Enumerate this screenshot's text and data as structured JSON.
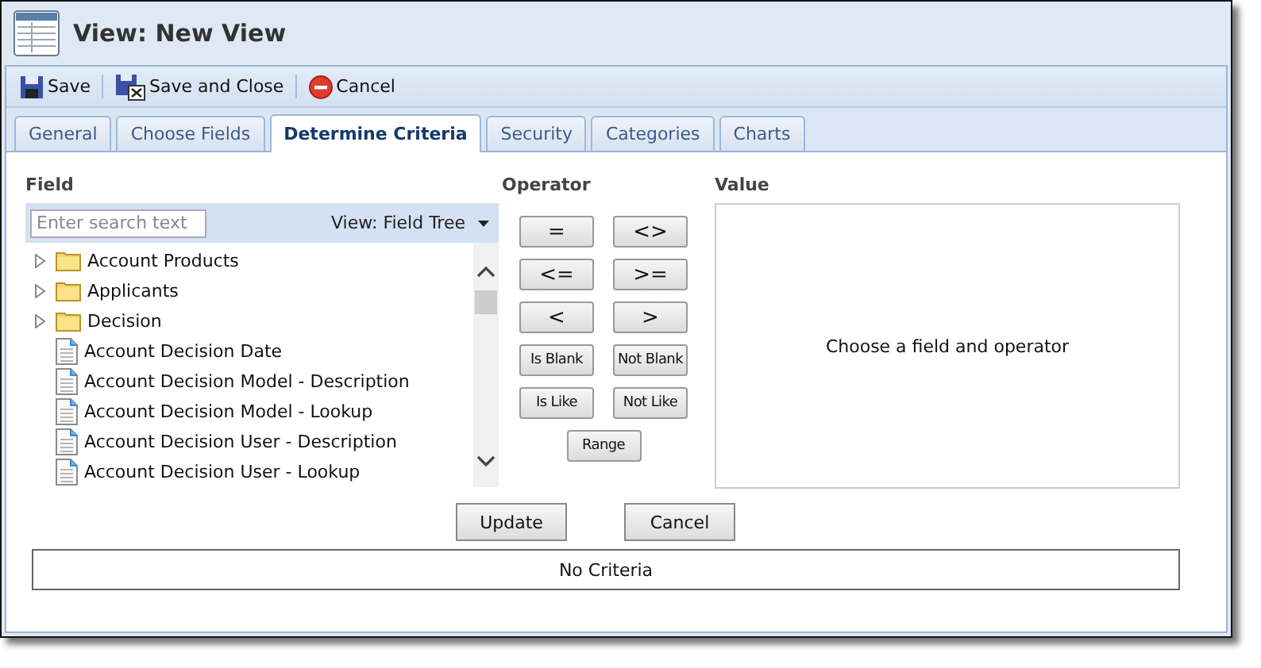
{
  "window": {
    "title": "View: New View"
  },
  "toolbar": [
    {
      "label": "Save",
      "kind": "save"
    },
    {
      "label": "Save and Close",
      "kind": "save_close"
    },
    {
      "label": "Cancel",
      "kind": "cancel"
    }
  ],
  "tabs": [
    {
      "label": "General",
      "selected": false
    },
    {
      "label": "Choose Fields",
      "selected": false
    },
    {
      "label": "Determine Criteria",
      "selected": true
    },
    {
      "label": "Security",
      "selected": false
    },
    {
      "label": "Categories",
      "selected": false
    },
    {
      "label": "Charts",
      "selected": false
    }
  ],
  "field": {
    "heading": "Field",
    "search": {
      "placeholder": "Enter search text"
    },
    "view_selector": "View: Field Tree",
    "tree": [
      {
        "label": "Account Products",
        "kind": "folder",
        "expanded": false
      },
      {
        "label": "Applicants",
        "kind": "folder",
        "expanded": false
      },
      {
        "label": "Decision",
        "kind": "folder",
        "expanded": false
      },
      {
        "label": "Account Decision Date",
        "kind": "field"
      },
      {
        "label": "Account Decision Model - Description",
        "kind": "field"
      },
      {
        "label": "Account Decision Model - Lookup",
        "kind": "field"
      },
      {
        "label": "Account Decision User - Description",
        "kind": "field"
      },
      {
        "label": "Account Decision User - Lookup",
        "kind": "field"
      }
    ]
  },
  "operator": {
    "heading": "Operator",
    "rows": [
      [
        "=",
        "<>"
      ],
      [
        "<=",
        ">="
      ],
      [
        "<",
        ">"
      ],
      [
        "Is Blank",
        "Not Blank"
      ],
      [
        "Is Like",
        "Not Like"
      ],
      [
        "Range"
      ]
    ]
  },
  "value": {
    "heading": "Value",
    "message": "Choose a field and operator"
  },
  "buttons": [
    "Update",
    "Cancel"
  ],
  "criteria": "No Criteria"
}
